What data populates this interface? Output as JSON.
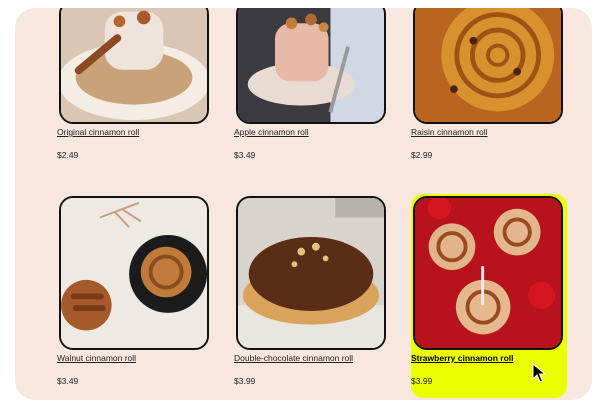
{
  "products": [
    {
      "name": "Original cinnamon roll",
      "price": "$2.49"
    },
    {
      "name": "Apple cinnamon roll",
      "price": "$3.49"
    },
    {
      "name": "Raisin cinnamon roll",
      "price": "$2.99"
    },
    {
      "name": "Walnut cinnamon roll",
      "price": "$3.49"
    },
    {
      "name": "Double-chocolate cinnamon roll",
      "price": "$3.99"
    },
    {
      "name": "Strawberry cinnamon roll",
      "price": "$3.99"
    }
  ],
  "colors": {
    "panel_bg": "#f7e7de",
    "highlight": "#eaff00",
    "image_border": "#111111"
  },
  "selected_index": 5
}
